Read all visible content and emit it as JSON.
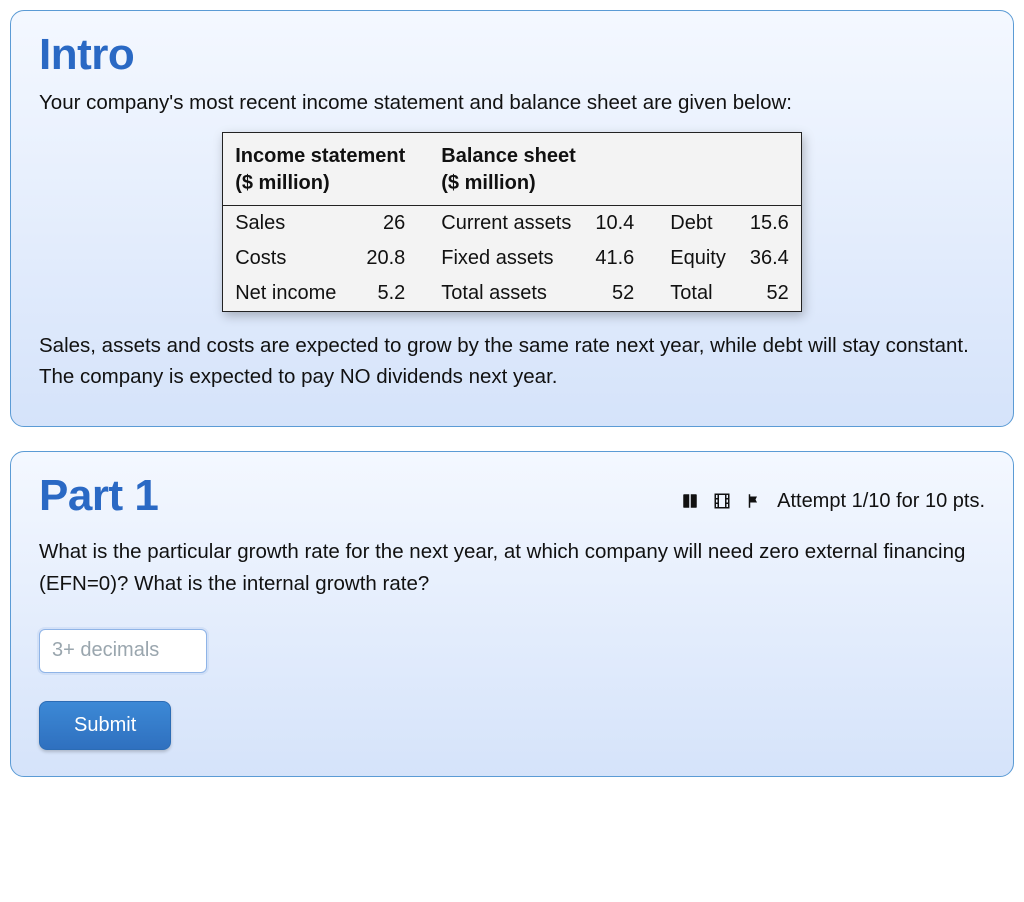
{
  "intro": {
    "title": "Intro",
    "lead": "Your company's most recent income statement and balance sheet are given below:",
    "table": {
      "head_income": "Income statement\n($ million)",
      "head_balance": "Balance sheet\n($ million)",
      "rows": [
        {
          "inc_label": "Sales",
          "inc_val": "26",
          "bal_label": "Current assets",
          "bal_val": "10.4",
          "liab_label": "Debt",
          "liab_val": "15.6"
        },
        {
          "inc_label": "Costs",
          "inc_val": "20.8",
          "bal_label": "Fixed assets",
          "bal_val": "41.6",
          "liab_label": "Equity",
          "liab_val": "36.4"
        },
        {
          "inc_label": "Net income",
          "inc_val": "5.2",
          "bal_label": "Total assets",
          "bal_val": "52",
          "liab_label": "Total",
          "liab_val": "52"
        }
      ]
    },
    "tail": "Sales, assets and costs are expected to grow by the same rate next year, while debt will stay constant. The company is expected to pay NO dividends next year."
  },
  "part1": {
    "title": "Part 1",
    "attempt_text": "Attempt 1/10 for 10 pts.",
    "question": "What is the particular growth rate for the next year, at which company will need zero external financing (EFN=0)? What is the internal growth rate?",
    "placeholder": "3+ decimals",
    "submit_label": "Submit"
  }
}
